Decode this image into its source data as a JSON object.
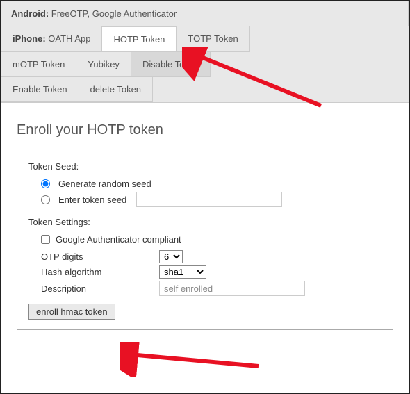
{
  "tabs": {
    "android_label": "Android:",
    "android_apps": " FreeOTP, Google Authenticator",
    "iphone_label": "iPhone:",
    "iphone_app": " OATH App",
    "hotp": "HOTP Token",
    "totp": "TOTP Token",
    "motp": "mOTP Token",
    "yubikey": "Yubikey",
    "disable": "Disable Token",
    "enable": "Enable Token",
    "delete": "delete Token"
  },
  "form": {
    "title": "Enroll your HOTP token",
    "seed_label": "Token Seed:",
    "radio_generate": "Generate random seed",
    "radio_enter": "Enter token seed",
    "settings_label": "Token Settings:",
    "gauth_compliant": "Google Authenticator compliant",
    "otp_digits_label": "OTP digits",
    "otp_digits_value": "6",
    "hash_label": "Hash algorithm",
    "hash_value": "sha1",
    "description_label": "Description",
    "description_value": "self enrolled",
    "enroll_button": "enroll hmac token"
  }
}
